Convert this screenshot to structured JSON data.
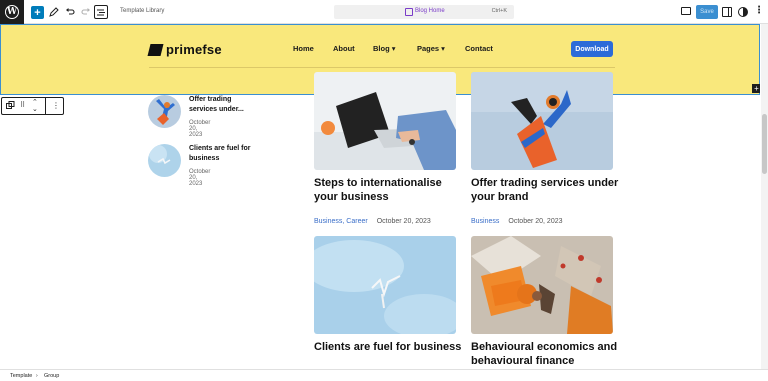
{
  "topbar": {
    "document_label": "Template Library",
    "command_title": "Blog Home",
    "command_shortcut": "Ctrl+K",
    "save_label": "Save"
  },
  "header": {
    "logo_text": "primefse",
    "nav": [
      "Home",
      "About",
      "Blog ▾",
      "Pages ▾",
      "Contact"
    ],
    "download_label": "Download"
  },
  "sidebar_posts": [
    {
      "title": "Offer trading services under...",
      "date": "October 20, 2023"
    },
    {
      "title": "Clients are fuel for business",
      "date": "October 20, 2023"
    }
  ],
  "cards": [
    {
      "title": "Steps to internationalise your business",
      "categories": "Business, Career",
      "date": "October 20, 2023"
    },
    {
      "title": "Offer trading services under your brand",
      "categories": "Business",
      "date": "October 20, 2023"
    },
    {
      "title": "Clients are fuel for business",
      "categories": "",
      "date": ""
    },
    {
      "title": "Behavioural economics and behavioural finance manifesto",
      "categories": "",
      "date": ""
    }
  ],
  "footer": {
    "breadcrumb": [
      "Template",
      "Group"
    ]
  },
  "colors": {
    "header_bg": "#f9e87c",
    "accent": "#2c6bd8",
    "category_link": "#3a6ec8"
  }
}
